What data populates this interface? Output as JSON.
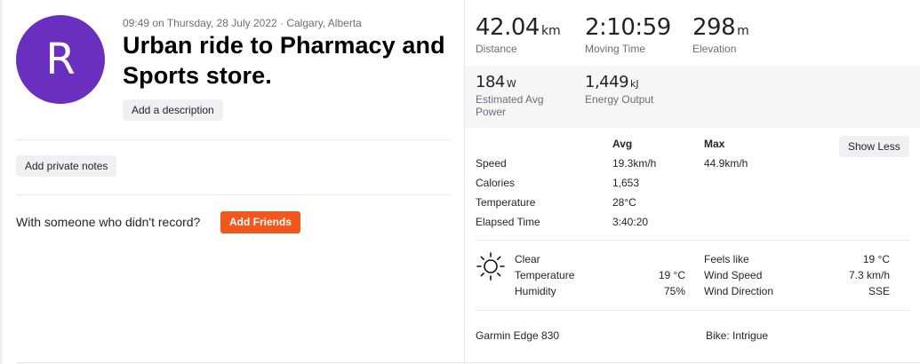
{
  "avatar": {
    "initial": "R"
  },
  "activity": {
    "meta": "09:49 on Thursday, 28 July 2022 · Calgary, Alberta",
    "title": "Urban ride to Pharmacy and Sports store.",
    "add_description": "Add a description",
    "add_private_notes": "Add private notes",
    "with_someone": "With someone who didn't record?",
    "add_friends": "Add Friends"
  },
  "primary_stats": [
    {
      "value": "42.04",
      "unit": "km",
      "label": "Distance"
    },
    {
      "value": "2:10:59",
      "unit": "",
      "label": "Moving Time"
    },
    {
      "value": "298",
      "unit": "m",
      "label": "Elevation"
    }
  ],
  "secondary_stats": [
    {
      "value": "184",
      "unit": "W",
      "label": "Estimated Avg Power"
    },
    {
      "value": "1,449",
      "unit": "kJ",
      "label": "Energy Output"
    }
  ],
  "more_stats": {
    "show_less": "Show Less",
    "header_avg": "Avg",
    "header_max": "Max",
    "rows": [
      {
        "label": "Speed",
        "avg": "19.3km/h",
        "max": "44.9km/h"
      },
      {
        "label": "Calories",
        "avg": "1,653",
        "max": ""
      },
      {
        "label": "Temperature",
        "avg": "28°C",
        "max": ""
      },
      {
        "label": "Elapsed Time",
        "avg": "3:40:20",
        "max": ""
      }
    ]
  },
  "weather": {
    "icon": "sun-icon",
    "condition": "Clear",
    "temperature_label": "Temperature",
    "temperature_value": "19 °C",
    "humidity_label": "Humidity",
    "humidity_value": "75%",
    "feels_like_label": "Feels like",
    "feels_like_value": "19 °C",
    "wind_speed_label": "Wind Speed",
    "wind_speed_value": "7.3 km/h",
    "wind_direction_label": "Wind Direction",
    "wind_direction_value": "SSE"
  },
  "device": "Garmin Edge 830",
  "bike": "Bike: Intrigue",
  "colors": {
    "avatar_bg": "#6a2fbf",
    "accent_orange": "#f2571b"
  }
}
